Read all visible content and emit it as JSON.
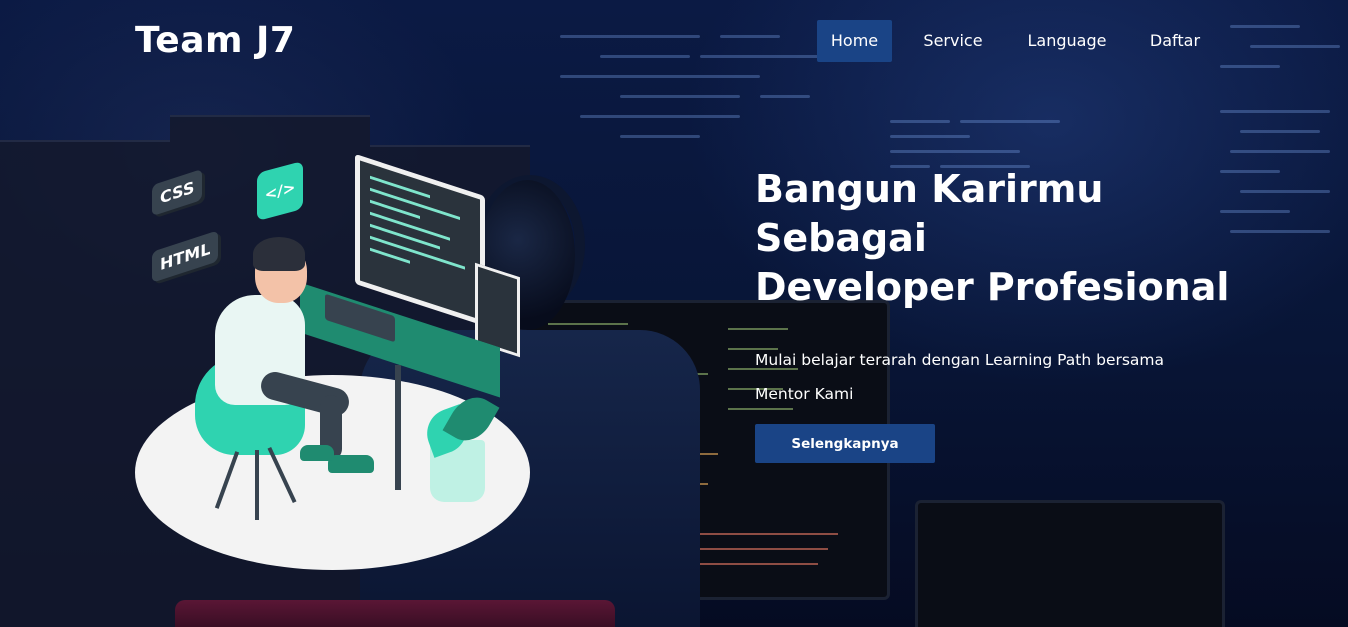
{
  "brand": {
    "name": "Team J7"
  },
  "nav": {
    "items": [
      {
        "label": "Home",
        "active": true
      },
      {
        "label": "Service",
        "active": false
      },
      {
        "label": "Language",
        "active": false
      },
      {
        "label": "Daftar",
        "active": false
      }
    ]
  },
  "hero": {
    "title_lines": [
      "Bangun Karirmu",
      "Sebagai",
      "Developer Profesional"
    ],
    "subtitle": "Mulai belajar terarah dengan Learning Path bersama Mentor Kami",
    "cta_label": "Selengkapnya"
  },
  "illustration": {
    "tag_css": "CSS",
    "tag_html": "HTML",
    "code_icon": "</>"
  },
  "colors": {
    "accent": "#1a4486",
    "background": "#06102e",
    "illustration_teal": "#2fd3b0"
  },
  "icons": {
    "code_bubble": "code-icon"
  }
}
